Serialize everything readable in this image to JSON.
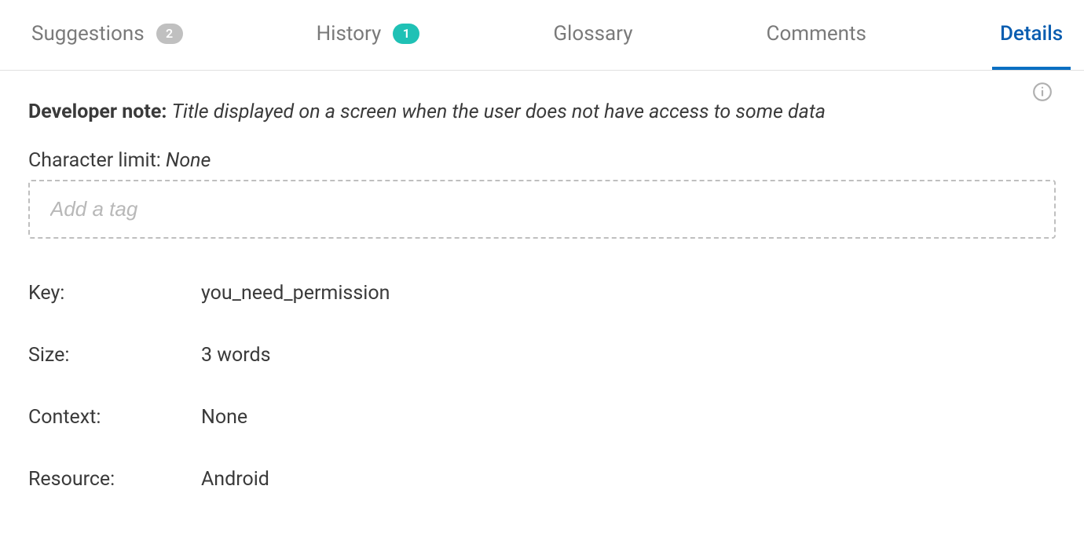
{
  "tabs": {
    "suggestions": {
      "label": "Suggestions",
      "badge": "2"
    },
    "history": {
      "label": "History",
      "badge": "1"
    },
    "glossary": {
      "label": "Glossary"
    },
    "comments": {
      "label": "Comments"
    },
    "details": {
      "label": "Details"
    }
  },
  "details": {
    "dev_note_label": "Developer note:",
    "dev_note_text": "Title displayed on a screen when the user does not have access to some data",
    "char_limit_label": "Character limit: ",
    "char_limit_value": "None",
    "tag_placeholder": "Add a tag",
    "meta": {
      "key_label": "Key:",
      "key_value": "you_need_permission",
      "size_label": "Size:",
      "size_value": "3 words",
      "context_label": "Context:",
      "context_value": "None",
      "resource_label": "Resource:",
      "resource_value": "Android"
    }
  }
}
